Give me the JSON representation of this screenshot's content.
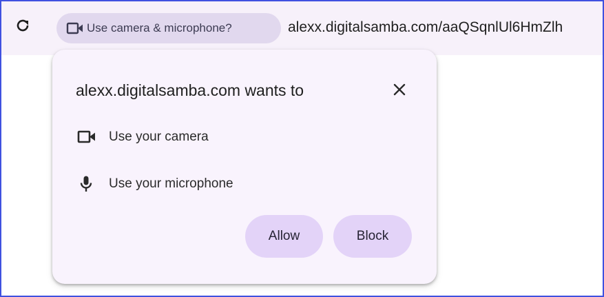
{
  "toolbar": {
    "reload_icon": "reload-icon",
    "chip": {
      "icon": "camera-icon",
      "label": "Use camera & microphone?"
    },
    "url": "alexx.digitalsamba.com/aaQSqnlUl6HmZlh"
  },
  "popup": {
    "title": "alexx.digitalsamba.com wants to",
    "close_icon": "close-icon",
    "permissions": [
      {
        "icon": "camera-icon",
        "label": "Use your camera"
      },
      {
        "icon": "microphone-icon",
        "label": "Use your microphone"
      }
    ],
    "allow_label": "Allow",
    "block_label": "Block"
  },
  "colors": {
    "frame_border": "#3f51e0",
    "toolbar_bg": "#f7f1fa",
    "chip_bg": "#e1d8ee",
    "popup_bg": "#f9f3fd",
    "button_bg": "#e3d3f8"
  }
}
